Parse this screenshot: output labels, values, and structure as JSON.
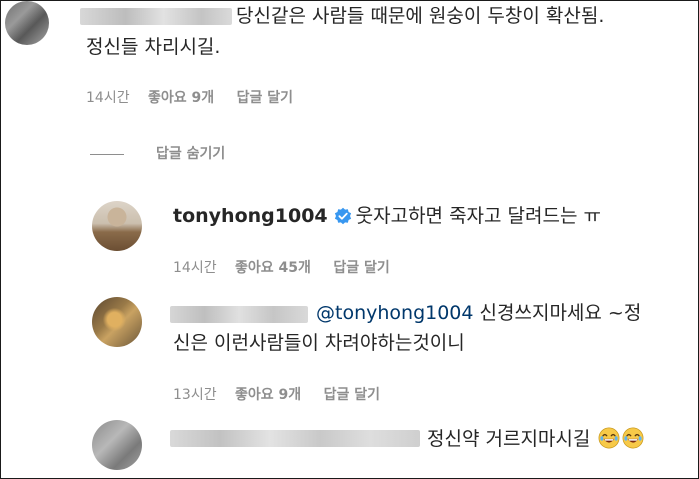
{
  "comment1": {
    "text_line1": "당신같은 사람들 때문에 원숭이 두창이 확산됨.",
    "text_line2": "정신들 차리시길.",
    "time": "14시간",
    "likes": "좋아요 9개",
    "reply": "답글 달기"
  },
  "hide_replies": "답글 숨기기",
  "reply1": {
    "username": "tonyhong1004",
    "text": "웃자고하면 죽자고 달려드는 ㅠ",
    "time": "14시간",
    "likes": "좋아요 45개",
    "reply": "답글 달기"
  },
  "reply2": {
    "mention": "@tonyhong1004",
    "text_line1": " 신경쓰지마세요 ~정",
    "text_line2": "신은 이런사람들이 차려야하는것이니",
    "time": "13시간",
    "likes": "좋아요 9개",
    "reply": "답글 달기"
  },
  "reply3": {
    "text": "정신약 거르지마시길"
  },
  "colors": {
    "verified": "#3897f0",
    "meta": "#8e8e8e",
    "mention": "#00376b"
  }
}
